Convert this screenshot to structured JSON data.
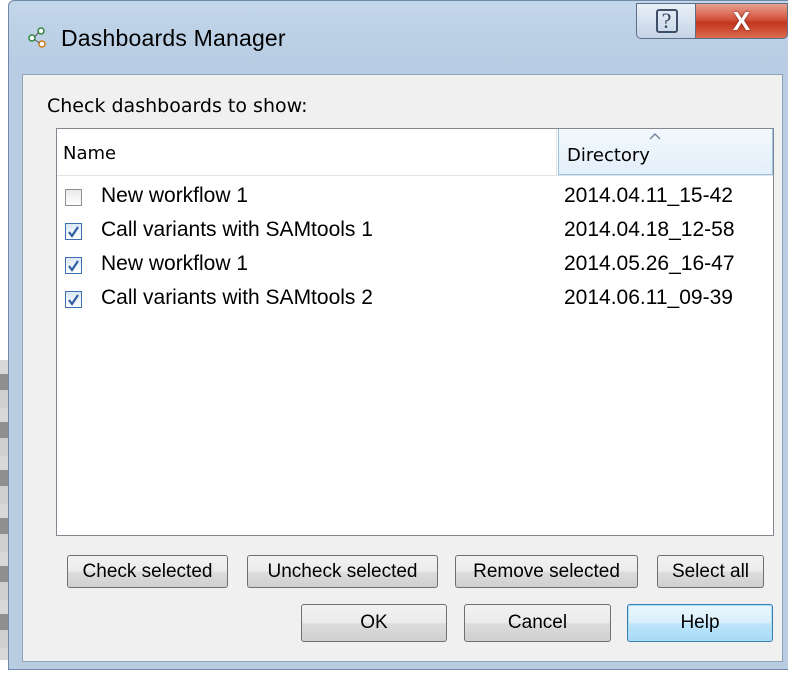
{
  "window": {
    "title": "Dashboards Manager",
    "help_glyph": "?",
    "close_glyph": "X",
    "icon": "dashboards-app-icon"
  },
  "prompt": "Check dashboards to show:",
  "list": {
    "columns": [
      "Name",
      "Directory"
    ],
    "sort_column": "Directory",
    "sort_icon": "sort-ascending-icon",
    "rows": [
      {
        "name": "New workflow 1",
        "directory": "2014.04.11_15-42",
        "checked": false
      },
      {
        "name": "Call variants with SAMtools 1",
        "directory": "2014.04.18_12-58",
        "checked": true
      },
      {
        "name": "New workflow 1",
        "directory": "2014.05.26_16-47",
        "checked": true
      },
      {
        "name": "Call variants with SAMtools 2",
        "directory": "2014.06.11_09-39",
        "checked": true
      }
    ]
  },
  "actions": {
    "check_selected": "Check selected",
    "uncheck_selected": "Uncheck selected",
    "remove_selected": "Remove selected",
    "select_all": "Select all"
  },
  "dialog_buttons": {
    "ok": "OK",
    "cancel": "Cancel",
    "help": "Help"
  },
  "colors": {
    "close_button": "#c3361f",
    "default_button_border": "#3c7fb1",
    "checkbox_checked_border": "#3c6fb0"
  }
}
